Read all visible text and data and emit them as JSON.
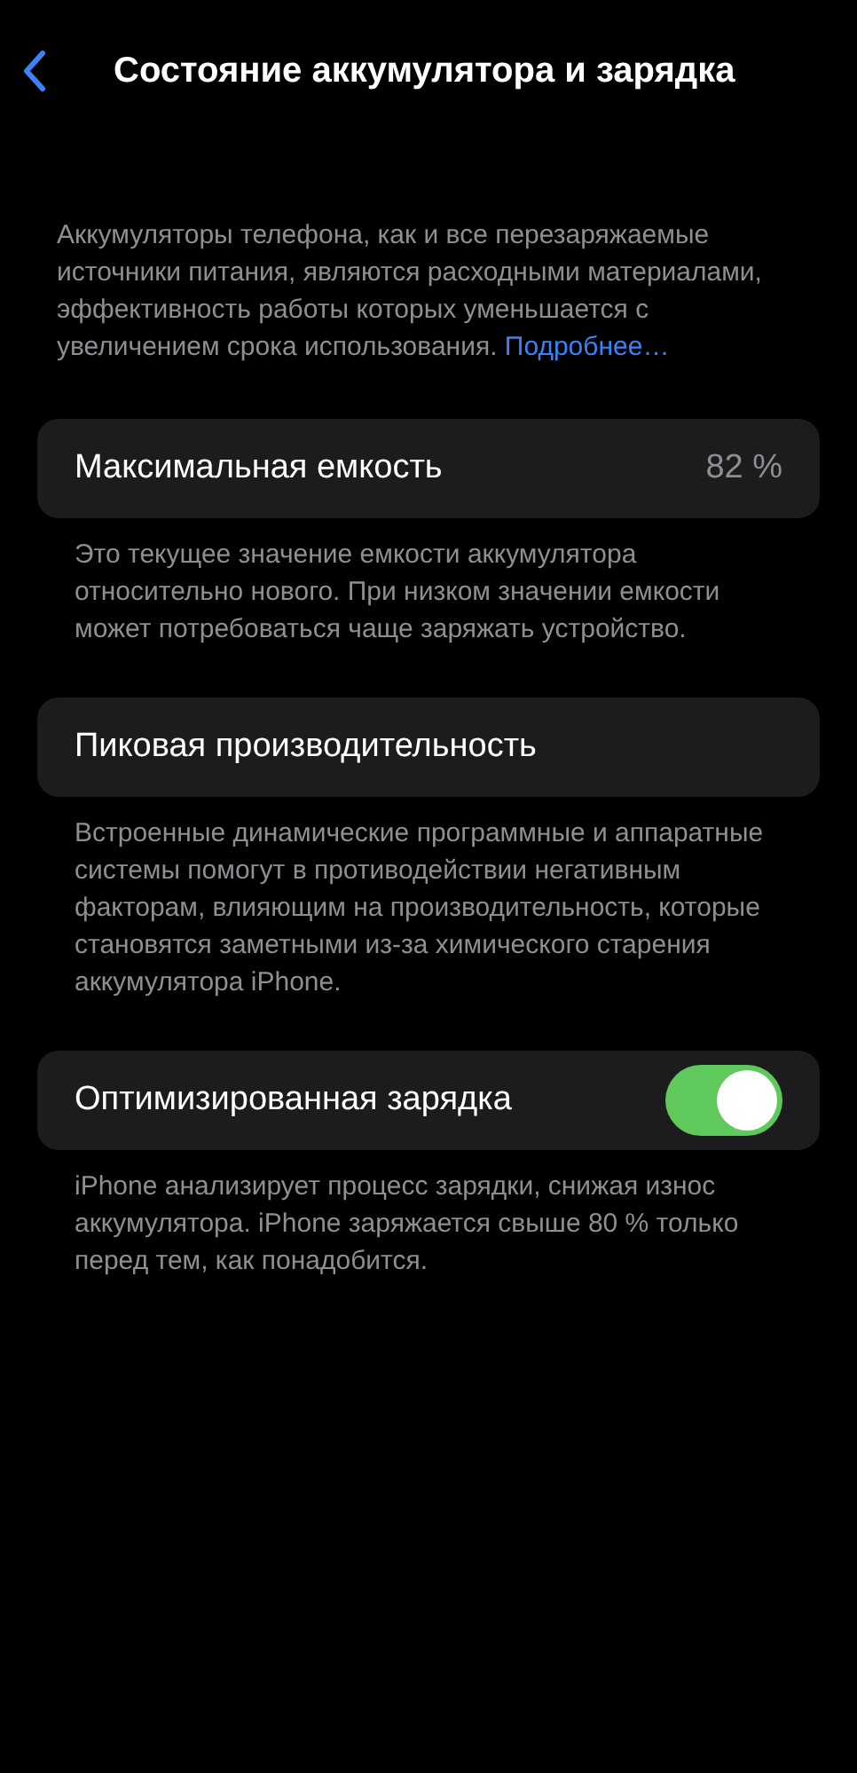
{
  "header": {
    "title": "Состояние аккумулятора и зарядка"
  },
  "intro": {
    "text": "Аккумуляторы телефона, как и все перезаряжаемые источники питания, являются расходными материалами, эффективность работы которых уменьшается с увеличением срока использования.",
    "link": "Подробнее…"
  },
  "sections": [
    {
      "kind": "value",
      "label": "Максимальная емкость",
      "value": "82 %",
      "footer": "Это текущее значение емкости аккумулятора относительно нового. При низком значении емкости может потребоваться чаще заряжать устройство."
    },
    {
      "kind": "plain",
      "label": "Пиковая производительность",
      "footer": "Встроенные динамические программные и аппаратные системы помогут в противодействии негативным факторам, влияющим на производительность, которые становятся заметными из-за химического старения аккумулятора iPhone."
    },
    {
      "kind": "toggle",
      "label": "Оптимизированная зарядка",
      "on": true,
      "footer": "iPhone анализирует процесс зарядки, снижая износ аккумулятора. iPhone заряжается свыше 80 % только перед тем, как понадобится."
    }
  ]
}
